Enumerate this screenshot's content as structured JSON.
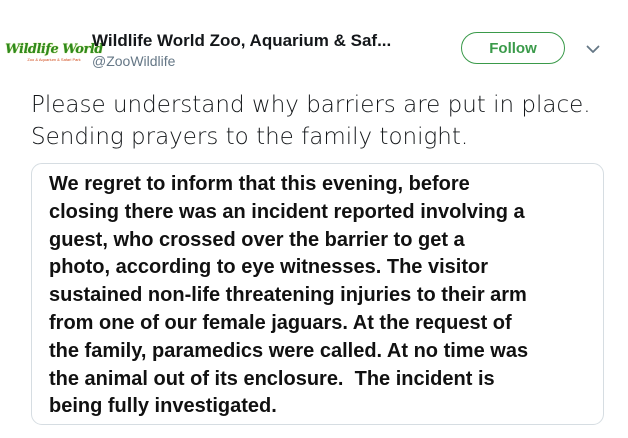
{
  "account": {
    "name": "Wildlife World Zoo, Aquarium & Saf...",
    "handle": "@ZooWildlife",
    "avatar_text": "Wildlife World",
    "avatar_subtext": "Zoo & Aquarium & Safari Park"
  },
  "follow_button": {
    "label": "Follow"
  },
  "menu": {
    "icon": "chevron-down-icon"
  },
  "tweet": {
    "text": "Please understand why barriers are put in place. Sending prayers to the family tonight."
  },
  "statement": {
    "lines": [
      "We regret to inform that this evening, before",
      "closing there was an incident reported involving a",
      "guest, who crossed over the barrier to get a",
      "photo, according to eye witnesses. The visitor",
      "sustained non-life threatening injuries to their arm",
      "from one of our female jaguars. At the request of",
      "the family, paramedics were called. At no time was",
      "the animal out of its enclosure.  The incident is",
      "being fully investigated."
    ]
  },
  "colors": {
    "accent": "#3a9a4a",
    "text": "#14171a",
    "secondary": "#657786",
    "border": "#d6dde2"
  }
}
